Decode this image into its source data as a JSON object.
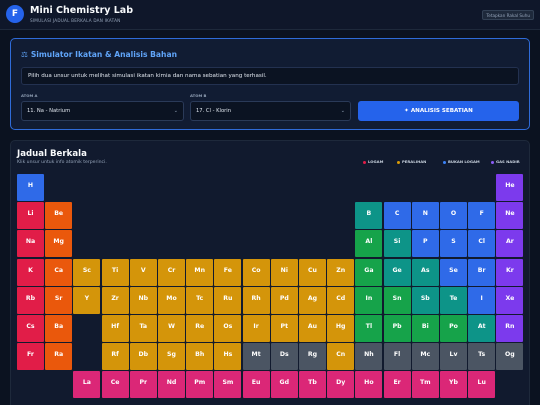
{
  "header": {
    "logo": "F",
    "title": "Mini Chemistry Lab",
    "subtitle": "SIMULASI JADUAL BERKALA DAN IKATAN",
    "reset_label": "Tetapkan Rakal Suhu"
  },
  "simulator": {
    "title": "Simulator Ikatan & Analisis Bahan",
    "info": "Pilih dua unsur untuk melihat simulasi ikatan kimia dan nama sebatian yang terhasil.",
    "atom_a_label": "ATOM A",
    "atom_a_value": "11. Na - Natrium",
    "atom_b_label": "ATOM B",
    "atom_b_value": "17. Cl - Klorin",
    "analyze_label": "ANALISIS SEBATIAN"
  },
  "table": {
    "title": "Jadual Berkala",
    "subtitle": "Klik unsur untuk info atomik terperinci.",
    "legend": [
      {
        "label": "LOGAM",
        "color": "#e11d48"
      },
      {
        "label": "PERALIHAN",
        "color": "#d99a06"
      },
      {
        "label": "BUKAN LOGAM",
        "color": "#3b82f6"
      },
      {
        "label": "GAS NADIR",
        "color": "#8b5cf6"
      }
    ],
    "colors": {
      "nonmetal": "#2f6ae8",
      "noble": "#7c3aed",
      "alkali": "#e11d48",
      "alkaline": "#ea580c",
      "transition": "#d4950a",
      "post": "#16a34a",
      "metalloid": "#0d9488",
      "halogen": "#2563eb",
      "unknown": "#4b5563",
      "lanth": "#db2777"
    },
    "elements": [
      {
        "s": "H",
        "r": 1,
        "c": 1,
        "t": "nonmetal"
      },
      {
        "s": "He",
        "r": 1,
        "c": 18,
        "t": "noble"
      },
      {
        "s": "Li",
        "r": 2,
        "c": 1,
        "t": "alkali"
      },
      {
        "s": "Be",
        "r": 2,
        "c": 2,
        "t": "alkaline"
      },
      {
        "s": "B",
        "r": 2,
        "c": 13,
        "t": "metalloid"
      },
      {
        "s": "C",
        "r": 2,
        "c": 14,
        "t": "nonmetal"
      },
      {
        "s": "N",
        "r": 2,
        "c": 15,
        "t": "nonmetal"
      },
      {
        "s": "O",
        "r": 2,
        "c": 16,
        "t": "nonmetal"
      },
      {
        "s": "F",
        "r": 2,
        "c": 17,
        "t": "nonmetal"
      },
      {
        "s": "Ne",
        "r": 2,
        "c": 18,
        "t": "noble"
      },
      {
        "s": "Na",
        "r": 3,
        "c": 1,
        "t": "alkali"
      },
      {
        "s": "Mg",
        "r": 3,
        "c": 2,
        "t": "alkaline"
      },
      {
        "s": "Al",
        "r": 3,
        "c": 13,
        "t": "post"
      },
      {
        "s": "Si",
        "r": 3,
        "c": 14,
        "t": "metalloid"
      },
      {
        "s": "P",
        "r": 3,
        "c": 15,
        "t": "nonmetal"
      },
      {
        "s": "S",
        "r": 3,
        "c": 16,
        "t": "nonmetal"
      },
      {
        "s": "Cl",
        "r": 3,
        "c": 17,
        "t": "nonmetal"
      },
      {
        "s": "Ar",
        "r": 3,
        "c": 18,
        "t": "noble"
      },
      {
        "s": "K",
        "r": 4,
        "c": 1,
        "t": "alkali"
      },
      {
        "s": "Ca",
        "r": 4,
        "c": 2,
        "t": "alkaline"
      },
      {
        "s": "Sc",
        "r": 4,
        "c": 3,
        "t": "transition"
      },
      {
        "s": "Ti",
        "r": 4,
        "c": 4,
        "t": "transition"
      },
      {
        "s": "V",
        "r": 4,
        "c": 5,
        "t": "transition"
      },
      {
        "s": "Cr",
        "r": 4,
        "c": 6,
        "t": "transition"
      },
      {
        "s": "Mn",
        "r": 4,
        "c": 7,
        "t": "transition"
      },
      {
        "s": "Fe",
        "r": 4,
        "c": 8,
        "t": "transition"
      },
      {
        "s": "Co",
        "r": 4,
        "c": 9,
        "t": "transition"
      },
      {
        "s": "Ni",
        "r": 4,
        "c": 10,
        "t": "transition"
      },
      {
        "s": "Cu",
        "r": 4,
        "c": 11,
        "t": "transition"
      },
      {
        "s": "Zn",
        "r": 4,
        "c": 12,
        "t": "transition"
      },
      {
        "s": "Ga",
        "r": 4,
        "c": 13,
        "t": "post"
      },
      {
        "s": "Ge",
        "r": 4,
        "c": 14,
        "t": "metalloid"
      },
      {
        "s": "As",
        "r": 4,
        "c": 15,
        "t": "metalloid"
      },
      {
        "s": "Se",
        "r": 4,
        "c": 16,
        "t": "nonmetal"
      },
      {
        "s": "Br",
        "r": 4,
        "c": 17,
        "t": "nonmetal"
      },
      {
        "s": "Kr",
        "r": 4,
        "c": 18,
        "t": "noble"
      },
      {
        "s": "Rb",
        "r": 5,
        "c": 1,
        "t": "alkali"
      },
      {
        "s": "Sr",
        "r": 5,
        "c": 2,
        "t": "alkaline"
      },
      {
        "s": "Y",
        "r": 5,
        "c": 3,
        "t": "transition"
      },
      {
        "s": "Zr",
        "r": 5,
        "c": 4,
        "t": "transition"
      },
      {
        "s": "Nb",
        "r": 5,
        "c": 5,
        "t": "transition"
      },
      {
        "s": "Mo",
        "r": 5,
        "c": 6,
        "t": "transition"
      },
      {
        "s": "Tc",
        "r": 5,
        "c": 7,
        "t": "transition"
      },
      {
        "s": "Ru",
        "r": 5,
        "c": 8,
        "t": "transition"
      },
      {
        "s": "Rh",
        "r": 5,
        "c": 9,
        "t": "transition"
      },
      {
        "s": "Pd",
        "r": 5,
        "c": 10,
        "t": "transition"
      },
      {
        "s": "Ag",
        "r": 5,
        "c": 11,
        "t": "transition"
      },
      {
        "s": "Cd",
        "r": 5,
        "c": 12,
        "t": "transition"
      },
      {
        "s": "In",
        "r": 5,
        "c": 13,
        "t": "post"
      },
      {
        "s": "Sn",
        "r": 5,
        "c": 14,
        "t": "post"
      },
      {
        "s": "Sb",
        "r": 5,
        "c": 15,
        "t": "metalloid"
      },
      {
        "s": "Te",
        "r": 5,
        "c": 16,
        "t": "metalloid"
      },
      {
        "s": "I",
        "r": 5,
        "c": 17,
        "t": "nonmetal"
      },
      {
        "s": "Xe",
        "r": 5,
        "c": 18,
        "t": "noble"
      },
      {
        "s": "Cs",
        "r": 6,
        "c": 1,
        "t": "alkali"
      },
      {
        "s": "Ba",
        "r": 6,
        "c": 2,
        "t": "alkaline"
      },
      {
        "s": "Hf",
        "r": 6,
        "c": 4,
        "t": "transition"
      },
      {
        "s": "Ta",
        "r": 6,
        "c": 5,
        "t": "transition"
      },
      {
        "s": "W",
        "r": 6,
        "c": 6,
        "t": "transition"
      },
      {
        "s": "Re",
        "r": 6,
        "c": 7,
        "t": "transition"
      },
      {
        "s": "Os",
        "r": 6,
        "c": 8,
        "t": "transition"
      },
      {
        "s": "Ir",
        "r": 6,
        "c": 9,
        "t": "transition"
      },
      {
        "s": "Pt",
        "r": 6,
        "c": 10,
        "t": "transition"
      },
      {
        "s": "Au",
        "r": 6,
        "c": 11,
        "t": "transition"
      },
      {
        "s": "Hg",
        "r": 6,
        "c": 12,
        "t": "transition"
      },
      {
        "s": "Tl",
        "r": 6,
        "c": 13,
        "t": "post"
      },
      {
        "s": "Pb",
        "r": 6,
        "c": 14,
        "t": "post"
      },
      {
        "s": "Bi",
        "r": 6,
        "c": 15,
        "t": "post"
      },
      {
        "s": "Po",
        "r": 6,
        "c": 16,
        "t": "post"
      },
      {
        "s": "At",
        "r": 6,
        "c": 17,
        "t": "metalloid"
      },
      {
        "s": "Rn",
        "r": 6,
        "c": 18,
        "t": "noble"
      },
      {
        "s": "Fr",
        "r": 7,
        "c": 1,
        "t": "alkali"
      },
      {
        "s": "Ra",
        "r": 7,
        "c": 2,
        "t": "alkaline"
      },
      {
        "s": "Rf",
        "r": 7,
        "c": 4,
        "t": "transition"
      },
      {
        "s": "Db",
        "r": 7,
        "c": 5,
        "t": "transition"
      },
      {
        "s": "Sg",
        "r": 7,
        "c": 6,
        "t": "transition"
      },
      {
        "s": "Bh",
        "r": 7,
        "c": 7,
        "t": "transition"
      },
      {
        "s": "Hs",
        "r": 7,
        "c": 8,
        "t": "transition"
      },
      {
        "s": "Mt",
        "r": 7,
        "c": 9,
        "t": "unknown"
      },
      {
        "s": "Ds",
        "r": 7,
        "c": 10,
        "t": "unknown"
      },
      {
        "s": "Rg",
        "r": 7,
        "c": 11,
        "t": "unknown"
      },
      {
        "s": "Cn",
        "r": 7,
        "c": 12,
        "t": "transition"
      },
      {
        "s": "Nh",
        "r": 7,
        "c": 13,
        "t": "unknown"
      },
      {
        "s": "Fl",
        "r": 7,
        "c": 14,
        "t": "unknown"
      },
      {
        "s": "Mc",
        "r": 7,
        "c": 15,
        "t": "unknown"
      },
      {
        "s": "Lv",
        "r": 7,
        "c": 16,
        "t": "unknown"
      },
      {
        "s": "Ts",
        "r": 7,
        "c": 17,
        "t": "unknown"
      },
      {
        "s": "Og",
        "r": 7,
        "c": 18,
        "t": "unknown"
      },
      {
        "s": "La",
        "r": 8,
        "c": 3,
        "t": "lanth"
      },
      {
        "s": "Ce",
        "r": 8,
        "c": 4,
        "t": "lanth"
      },
      {
        "s": "Pr",
        "r": 8,
        "c": 5,
        "t": "lanth"
      },
      {
        "s": "Nd",
        "r": 8,
        "c": 6,
        "t": "lanth"
      },
      {
        "s": "Pm",
        "r": 8,
        "c": 7,
        "t": "lanth"
      },
      {
        "s": "Sm",
        "r": 8,
        "c": 8,
        "t": "lanth"
      },
      {
        "s": "Eu",
        "r": 8,
        "c": 9,
        "t": "lanth"
      },
      {
        "s": "Gd",
        "r": 8,
        "c": 10,
        "t": "lanth"
      },
      {
        "s": "Tb",
        "r": 8,
        "c": 11,
        "t": "lanth"
      },
      {
        "s": "Dy",
        "r": 8,
        "c": 12,
        "t": "lanth"
      },
      {
        "s": "Ho",
        "r": 8,
        "c": 13,
        "t": "lanth"
      },
      {
        "s": "Er",
        "r": 8,
        "c": 14,
        "t": "lanth"
      },
      {
        "s": "Tm",
        "r": 8,
        "c": 15,
        "t": "lanth"
      },
      {
        "s": "Yb",
        "r": 8,
        "c": 16,
        "t": "lanth"
      },
      {
        "s": "Lu",
        "r": 8,
        "c": 17,
        "t": "lanth"
      }
    ]
  }
}
